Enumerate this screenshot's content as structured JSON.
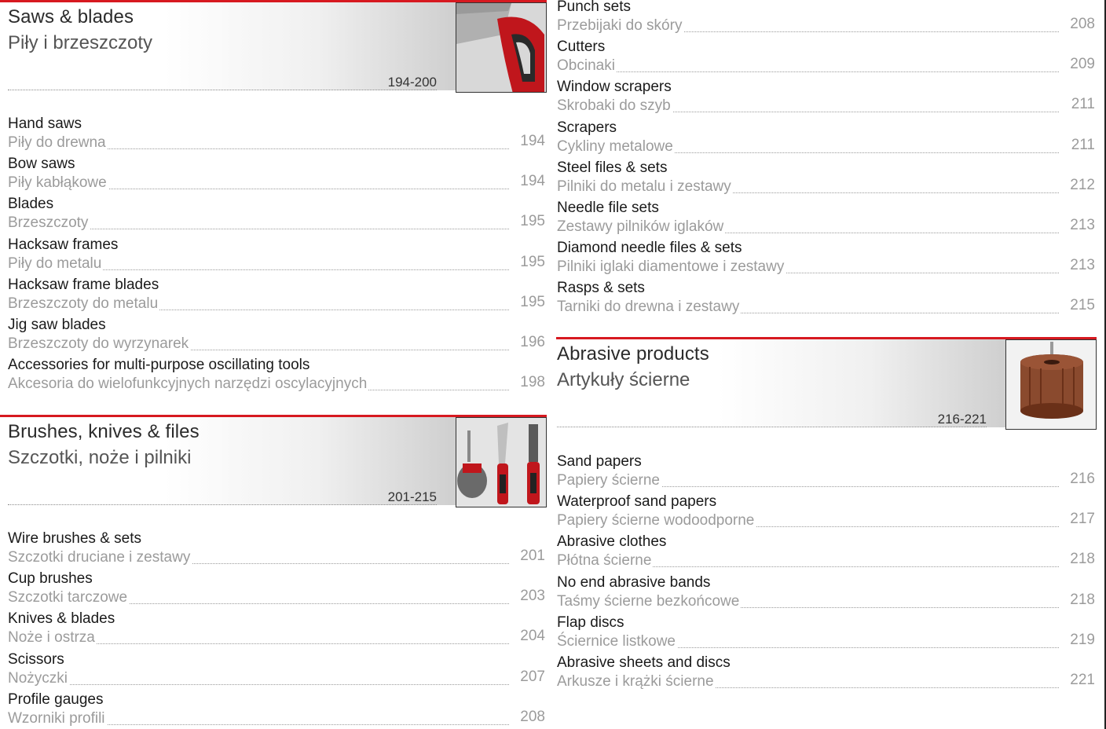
{
  "left": {
    "saws": {
      "title": "Saws & blades",
      "subtitle": "Piły i brzeszczoty",
      "pages": "194-200",
      "photo_icon": "hand-saw-icon",
      "items": [
        {
          "en": "Hand saws",
          "pl": "Piły do drewna",
          "page": "194"
        },
        {
          "en": "Bow saws",
          "pl": "Piły kabłąkowe",
          "page": "194"
        },
        {
          "en": "Blades",
          "pl": "Brzeszczoty",
          "page": "195"
        },
        {
          "en": "Hacksaw frames",
          "pl": "Piły do metalu",
          "page": "195"
        },
        {
          "en": "Hacksaw frame blades",
          "pl": "Brzeszczoty do metalu",
          "page": "195"
        },
        {
          "en": "Jig saw blades",
          "pl": "Brzeszczoty do wyrzynarek",
          "page": "196"
        },
        {
          "en": "Accessories for multi-purpose oscillating tools",
          "pl": "Akcesoria do wielofunkcyjnych narzędzi oscylacyjnych",
          "page": "198"
        }
      ]
    },
    "brushes": {
      "title": "Brushes, knives & files",
      "subtitle": "Szczotki, noże i pilniki",
      "pages": "201-215",
      "photo_icon": "brush-knife-icon",
      "items": [
        {
          "en": "Wire brushes & sets",
          "pl": "Szczotki druciane i zestawy",
          "page": "201"
        },
        {
          "en": "Cup brushes",
          "pl": "Szczotki tarczowe",
          "page": "203"
        },
        {
          "en": "Knives & blades",
          "pl": "Noże i ostrza",
          "page": "204"
        },
        {
          "en": "Scissors",
          "pl": "Nożyczki",
          "page": "207"
        },
        {
          "en": "Profile gauges",
          "pl": "Wzorniki profili",
          "page": "208"
        }
      ]
    }
  },
  "right": {
    "tools": {
      "items": [
        {
          "en": "Punch sets",
          "pl": "Przebijaki do skóry",
          "page": "208"
        },
        {
          "en": "Cutters",
          "pl": "Obcinaki",
          "page": "209"
        },
        {
          "en": "Window scrapers",
          "pl": "Skrobaki do szyb",
          "page": "211"
        },
        {
          "en": "Scrapers",
          "pl": "Cykliny metalowe",
          "page": "211"
        },
        {
          "en": "Steel files & sets",
          "pl": "Pilniki do metalu i zestawy",
          "page": "212"
        },
        {
          "en": "Needle file sets",
          "pl": "Zestawy pilników iglaków",
          "page": "213"
        },
        {
          "en": "Diamond needle files & sets",
          "pl": "Pilniki iglaki diamentowe i zestawy",
          "page": "213"
        },
        {
          "en": "Rasps & sets",
          "pl": "Tarniki do drewna i zestawy",
          "page": "215"
        }
      ]
    },
    "abrasive": {
      "title": "Abrasive products",
      "subtitle": "Artykuły ścierne",
      "pages": "216-221",
      "photo_icon": "flap-wheel-icon",
      "items": [
        {
          "en": "Sand papers",
          "pl": "Papiery ścierne",
          "page": "216"
        },
        {
          "en": "Waterproof sand papers",
          "pl": "Papiery ścierne wodoodporne",
          "page": "217"
        },
        {
          "en": "Abrasive clothes",
          "pl": "Płótna ścierne",
          "page": "218"
        },
        {
          "en": "No end abrasive bands",
          "pl": "Taśmy ścierne bezkońcowe",
          "page": "218"
        },
        {
          "en": "Flap discs",
          "pl": "Ściernice listkowe",
          "page": "219"
        },
        {
          "en": "Abrasive sheets and discs",
          "pl": "Arkusze i krążki ścierne",
          "page": "221"
        }
      ]
    }
  },
  "colors": {
    "accent": "#d71920",
    "heading": "#1a1a1a",
    "muted": "#9b9b9b"
  }
}
